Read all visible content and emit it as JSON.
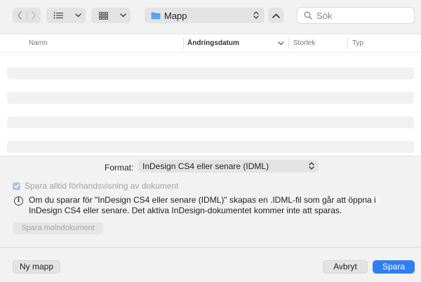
{
  "toolbar": {
    "back_icon": "chevron-left-icon",
    "forward_icon": "chevron-right-icon",
    "list_view_icon": "list-icon",
    "grid_view_icon": "grid-icon",
    "location": "Mapp",
    "location_icon": "folder-icon",
    "search_placeholder": "Sök"
  },
  "browser": {
    "columns": {
      "name": "Namn",
      "date": "Ändringsdatum",
      "size": "Storlek",
      "type": "Typ"
    }
  },
  "options": {
    "format_label": "Format:",
    "format_value": "InDesign CS4 eller senare (IDML)",
    "preview_checkbox_label": "Spara alltid förhandsvisning av dokument",
    "preview_checked": true,
    "info_text": "Om du sparar för \"InDesign CS4 eller senare (IDML)\" skapas en .IDML-fil som går att öppna i InDesign CS4 eller senare. Det aktiva InDesign-dokumentet kommer inte att sparas.",
    "cloud_button": "Spara molndokument"
  },
  "footer": {
    "new_folder": "Ny mapp",
    "cancel": "Avbryt",
    "save": "Spara"
  },
  "colors": {
    "accent": "#2f7ef2",
    "folder": "#5aa9f0"
  }
}
